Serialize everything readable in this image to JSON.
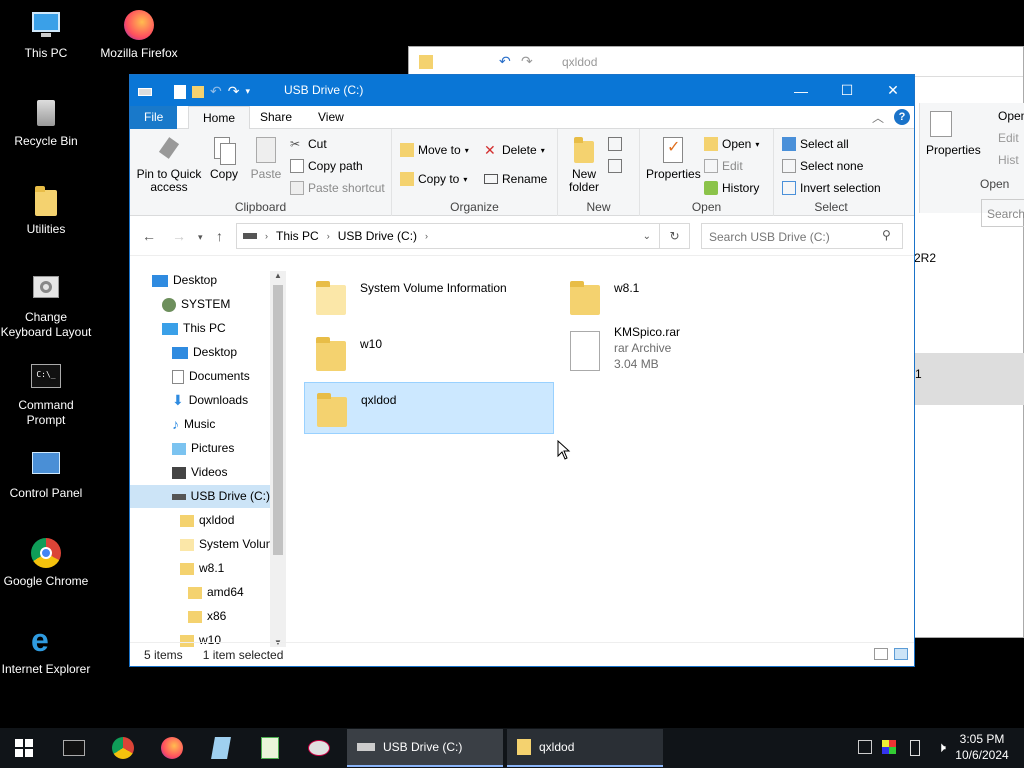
{
  "desktop": {
    "icons": [
      {
        "label": "This PC"
      },
      {
        "label": "Mozilla Firefox"
      },
      {
        "label": "Recycle Bin"
      },
      {
        "label": "Utilities"
      },
      {
        "label": "Change Keyboard Layout"
      },
      {
        "label": "Command Prompt"
      },
      {
        "label": "Control Panel"
      },
      {
        "label": "Google Chrome"
      },
      {
        "label": "Internet Explorer"
      }
    ]
  },
  "back_window": {
    "title": "qxldod",
    "properties_label": "Properties",
    "open_label": "Open",
    "edit_label": "Edit",
    "history_label": "Hist",
    "open_group": "Open",
    "search_placeholder": "Search",
    "snippet_1": "2R2",
    "snippet_2": "1"
  },
  "window": {
    "title": "USB Drive (C:)",
    "tabs": {
      "file": "File",
      "home": "Home",
      "share": "Share",
      "view": "View"
    },
    "ribbon": {
      "pin": "Pin to Quick access",
      "copy": "Copy",
      "paste": "Paste",
      "cut": "Cut",
      "copy_path": "Copy path",
      "paste_shortcut": "Paste shortcut",
      "clipboard": "Clipboard",
      "move_to": "Move to",
      "copy_to": "Copy to",
      "delete": "Delete",
      "rename": "Rename",
      "organize": "Organize",
      "new_folder": "New folder",
      "new": "New",
      "properties": "Properties",
      "open": "Open",
      "edit": "Edit",
      "history": "History",
      "open_group": "Open",
      "select_all": "Select all",
      "select_none": "Select none",
      "invert_selection": "Invert selection",
      "select_group": "Select"
    },
    "address": {
      "this_pc": "This PC",
      "drive": "USB Drive (C:)"
    },
    "search_placeholder": "Search USB Drive (C:)",
    "nav": [
      {
        "label": "Desktop"
      },
      {
        "label": "SYSTEM"
      },
      {
        "label": "This PC"
      },
      {
        "label": "Desktop"
      },
      {
        "label": "Documents"
      },
      {
        "label": "Downloads"
      },
      {
        "label": "Music"
      },
      {
        "label": "Pictures"
      },
      {
        "label": "Videos"
      },
      {
        "label": "USB Drive (C:)"
      },
      {
        "label": "qxldod"
      },
      {
        "label": "System Volun"
      },
      {
        "label": "w8.1"
      },
      {
        "label": "amd64"
      },
      {
        "label": "x86"
      },
      {
        "label": "w10"
      }
    ],
    "files": [
      {
        "name": "System Volume Information"
      },
      {
        "name": "w8.1"
      },
      {
        "name": "w10"
      },
      {
        "name": "KMSpico.rar",
        "type": "rar Archive",
        "size": "3.04 MB"
      },
      {
        "name": "qxldod"
      }
    ],
    "status": {
      "count": "5 items",
      "selected": "1 item selected"
    }
  },
  "taskbar": {
    "tasks": [
      {
        "label": "USB Drive (C:)"
      },
      {
        "label": "qxldod"
      }
    ],
    "time": "3:05 PM",
    "date": "10/6/2024"
  }
}
